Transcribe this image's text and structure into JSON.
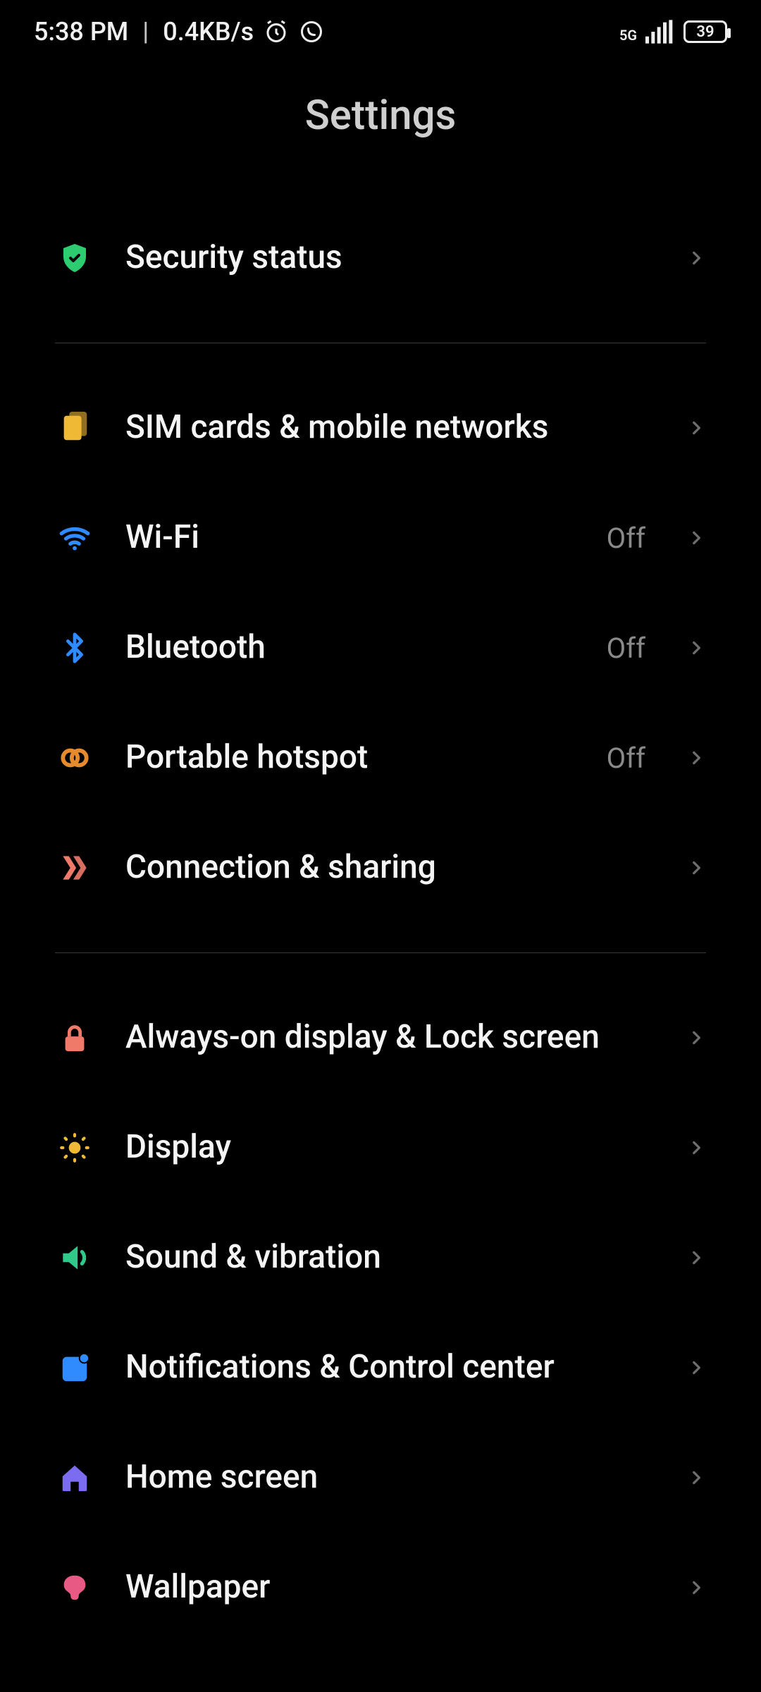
{
  "statusbar": {
    "time": "5:38 PM",
    "net_speed": "0.4KB/s",
    "net_label": "5G",
    "battery_pct": "39"
  },
  "header": {
    "title": "Settings"
  },
  "groups": [
    {
      "items": [
        {
          "id": "security-status",
          "label": "Security status"
        }
      ]
    },
    {
      "items": [
        {
          "id": "sim",
          "label": "SIM cards & mobile networks"
        },
        {
          "id": "wifi",
          "label": "Wi-Fi",
          "value": "Off"
        },
        {
          "id": "bluetooth",
          "label": "Bluetooth",
          "value": "Off"
        },
        {
          "id": "hotspot",
          "label": "Portable hotspot",
          "value": "Off"
        },
        {
          "id": "connection",
          "label": "Connection & sharing"
        }
      ]
    },
    {
      "items": [
        {
          "id": "aod",
          "label": "Always-on display & Lock screen"
        },
        {
          "id": "display",
          "label": "Display"
        },
        {
          "id": "sound",
          "label": "Sound & vibration"
        },
        {
          "id": "notif",
          "label": "Notifications & Control center"
        },
        {
          "id": "home",
          "label": "Home screen"
        },
        {
          "id": "wallpaper",
          "label": "Wallpaper"
        }
      ]
    }
  ]
}
